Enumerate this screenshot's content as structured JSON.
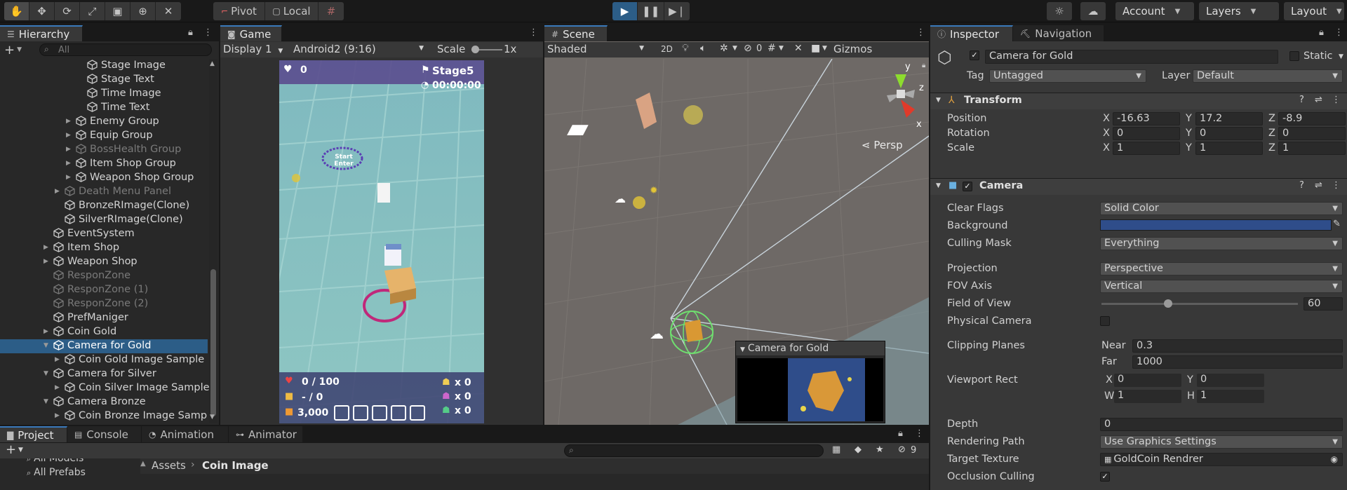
{
  "toolbar": {
    "tools": [
      "hand-tool-icon",
      "move-tool-icon",
      "rotate-tool-icon",
      "scale-tool-icon",
      "rect-tool-icon",
      "transform-tool-icon",
      "custom-tool-icon"
    ],
    "pivot_label": "Pivot",
    "local_label": "Local",
    "account_label": "Account",
    "layers_label": "Layers",
    "layout_label": "Layout"
  },
  "hierarchy": {
    "tab_label": "Hierarchy",
    "search_placeholder": "All",
    "rows": [
      {
        "label": "Stage Image",
        "indent": 5,
        "arrow": false,
        "dim": false
      },
      {
        "label": "Stage Text",
        "indent": 5,
        "arrow": false,
        "dim": false
      },
      {
        "label": "Time Image",
        "indent": 5,
        "arrow": false,
        "dim": false
      },
      {
        "label": "Time Text",
        "indent": 5,
        "arrow": false,
        "dim": false
      },
      {
        "label": "Enemy Group",
        "indent": 4,
        "arrow": true,
        "dim": false
      },
      {
        "label": "Equip Group",
        "indent": 4,
        "arrow": true,
        "dim": false
      },
      {
        "label": "BossHealth Group",
        "indent": 4,
        "arrow": true,
        "dim": true
      },
      {
        "label": "Item Shop Group",
        "indent": 4,
        "arrow": true,
        "dim": false
      },
      {
        "label": "Weapon Shop Group",
        "indent": 4,
        "arrow": true,
        "dim": false
      },
      {
        "label": "Death Menu Panel",
        "indent": 3,
        "arrow": true,
        "dim": true
      },
      {
        "label": "BronzeRImage(Clone)",
        "indent": 3,
        "arrow": false,
        "dim": false
      },
      {
        "label": "SilverRImage(Clone)",
        "indent": 3,
        "arrow": false,
        "dim": false
      },
      {
        "label": "EventSystem",
        "indent": 2,
        "arrow": false,
        "dim": false
      },
      {
        "label": "Item Shop",
        "indent": 2,
        "arrow": true,
        "dim": false
      },
      {
        "label": "Weapon Shop",
        "indent": 2,
        "arrow": true,
        "dim": false
      },
      {
        "label": "ResponZone",
        "indent": 2,
        "arrow": false,
        "dim": true
      },
      {
        "label": "ResponZone (1)",
        "indent": 2,
        "arrow": false,
        "dim": true
      },
      {
        "label": "ResponZone (2)",
        "indent": 2,
        "arrow": false,
        "dim": true
      },
      {
        "label": "PrefManiger",
        "indent": 2,
        "arrow": false,
        "dim": false
      },
      {
        "label": "Coin Gold",
        "indent": 2,
        "arrow": true,
        "dim": false
      },
      {
        "label": "Camera for Gold",
        "indent": 2,
        "arrow": true,
        "dim": false,
        "selected": true,
        "open": true
      },
      {
        "label": "Coin Gold Image Sample",
        "indent": 3,
        "arrow": true,
        "dim": false
      },
      {
        "label": "Camera for Silver",
        "indent": 2,
        "arrow": true,
        "dim": false,
        "open": true
      },
      {
        "label": "Coin Silver Image Sample",
        "indent": 3,
        "arrow": true,
        "dim": false
      },
      {
        "label": "Camera Bronze",
        "indent": 2,
        "arrow": true,
        "dim": false,
        "open": true
      },
      {
        "label": "Coin Bronze Image Samp",
        "indent": 3,
        "arrow": true,
        "dim": false
      }
    ]
  },
  "game": {
    "tab_label": "Game",
    "display": "Display 1",
    "resolution": "Android2 (9:16)",
    "scale_label": "Scale",
    "scale_value": "1x",
    "hud": {
      "lives": "0",
      "stage": "Stage5",
      "timer": "00:00:00",
      "start_text": "Start Enter",
      "health": "0 / 100",
      "ammo": "- / 0",
      "gold": "3,000",
      "counts": [
        "x 0",
        "x 0",
        "x 0"
      ]
    }
  },
  "scene": {
    "tab_label": "Scene",
    "shading": "Shaded",
    "mode_2d": "2D",
    "hidden_count": "0",
    "gizmos_label": "Gizmos",
    "persp_label": "Persp",
    "axis_labels": [
      "y",
      "z",
      "x"
    ],
    "preview_title": "Camera for Gold"
  },
  "inspector": {
    "tab_label": "Inspector",
    "nav_tab_label": "Navigation",
    "object_name": "Camera for Gold",
    "static_label": "Static",
    "tag_label": "Tag",
    "tag_value": "Untagged",
    "layer_label": "Layer",
    "layer_value": "Default",
    "transform": {
      "title": "Transform",
      "position_label": "Position",
      "rotation_label": "Rotation",
      "scale_label": "Scale",
      "position": [
        "-16.63",
        "17.2",
        "-8.9"
      ],
      "rotation": [
        "0",
        "0",
        "0"
      ],
      "scale": [
        "1",
        "1",
        "1"
      ],
      "axes": [
        "X",
        "Y",
        "Z"
      ]
    },
    "camera": {
      "title": "Camera",
      "clear_flags_label": "Clear Flags",
      "clear_flags": "Solid Color",
      "background_label": "Background",
      "background_color": "#2f4d8a",
      "culling_mask_label": "Culling Mask",
      "culling_mask": "Everything",
      "projection_label": "Projection",
      "projection": "Perspective",
      "fov_axis_label": "FOV Axis",
      "fov_axis": "Vertical",
      "fov_label": "Field of View",
      "fov_value": "60",
      "fov_fraction": 0.34,
      "physical_label": "Physical Camera",
      "clipping_label": "Clipping Planes",
      "near_label": "Near",
      "near": "0.3",
      "far_label": "Far",
      "far": "1000",
      "viewport_label": "Viewport Rect",
      "vp_x_label": "X",
      "vp_x": "0",
      "vp_y_label": "Y",
      "vp_y": "0",
      "vp_w_label": "W",
      "vp_w": "1",
      "vp_h_label": "H",
      "vp_h": "1",
      "depth_label": "Depth",
      "depth": "0",
      "rendering_path_label": "Rendering Path",
      "rendering_path": "Use Graphics Settings",
      "target_texture_label": "Target Texture",
      "target_texture": "GoldCoin Rendrer",
      "occlusion_label": "Occlusion Culling"
    }
  },
  "bottom": {
    "tabs": [
      "Project",
      "Console",
      "Animation",
      "Animator"
    ],
    "tree_items": [
      "All Models",
      "All Prefabs"
    ],
    "breadcrumb_root": "Assets",
    "breadcrumb_leaf": "Coin Image",
    "hidden_count": "9"
  }
}
